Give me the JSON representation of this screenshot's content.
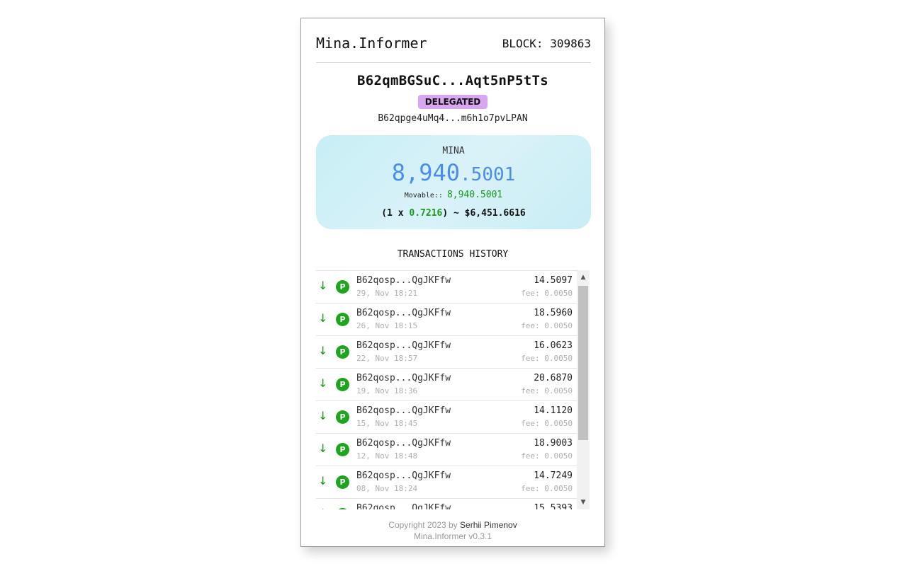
{
  "header": {
    "app_title": "Mina.Informer",
    "block_label": "BLOCK: 309863"
  },
  "account": {
    "address": "B62qmBGSuC...Aqt5nP5tTs",
    "status_badge": "DELEGATED",
    "delegate_address": "B62qpge4uMq4...m6h1o7pvLPAN"
  },
  "balance": {
    "currency": "MINA",
    "integer": "8,940",
    "decimal": ".5001",
    "movable_label": "Movable::",
    "movable_value": "8,940.5001",
    "rate_prefix": "(1 x ",
    "rate_value": "0.7216",
    "rate_suffix": ") ~ $6,451.6616"
  },
  "transactions": {
    "title": "TRANSACTIONS HISTORY",
    "items": [
      {
        "direction": "↓",
        "type": "P",
        "address": "B62qosp...QgJKFfw",
        "date": "29, Nov 18:21",
        "amount": "14.5097",
        "fee": "fee: 0.0050"
      },
      {
        "direction": "↓",
        "type": "P",
        "address": "B62qosp...QgJKFfw",
        "date": "26, Nov 18:15",
        "amount": "18.5960",
        "fee": "fee: 0.0050"
      },
      {
        "direction": "↓",
        "type": "P",
        "address": "B62qosp...QgJKFfw",
        "date": "22, Nov 18:57",
        "amount": "16.0623",
        "fee": "fee: 0.0050"
      },
      {
        "direction": "↓",
        "type": "P",
        "address": "B62qosp...QgJKFfw",
        "date": "19, Nov 18:36",
        "amount": "20.6870",
        "fee": "fee: 0.0050"
      },
      {
        "direction": "↓",
        "type": "P",
        "address": "B62qosp...QgJKFfw",
        "date": "15, Nov 18:45",
        "amount": "14.1120",
        "fee": "fee: 0.0050"
      },
      {
        "direction": "↓",
        "type": "P",
        "address": "B62qosp...QgJKFfw",
        "date": "12, Nov 18:48",
        "amount": "18.9003",
        "fee": "fee: 0.0050"
      },
      {
        "direction": "↓",
        "type": "P",
        "address": "B62qosp...QgJKFfw",
        "date": "08, Nov 18:24",
        "amount": "14.7249",
        "fee": "fee: 0.0050"
      },
      {
        "direction": "↓",
        "type": "P",
        "address": "B62qosp...QgJKFfw",
        "date": "",
        "amount": "15.5393",
        "fee": ""
      }
    ]
  },
  "footer": {
    "copyright_prefix": "Copyright 2023 by ",
    "author": "Serhii Pimenov",
    "version": "Mina.Informer v0.3.1"
  },
  "colors": {
    "accent_blue": "#4a8cf0",
    "green": "#1b9a1b",
    "badge_purple": "#d9a6f2"
  }
}
